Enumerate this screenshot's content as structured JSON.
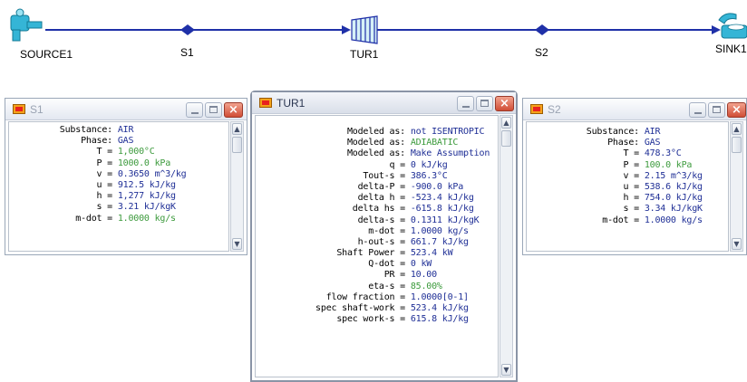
{
  "diagram": {
    "nodes": {
      "source": {
        "label": "SOURCE1",
        "icon": "faucet-icon"
      },
      "s1": {
        "label": "S1",
        "icon": "stream-diamond-icon"
      },
      "tur": {
        "label": "TUR1",
        "icon": "turbine-icon"
      },
      "s2": {
        "label": "S2",
        "icon": "stream-diamond-icon"
      },
      "sink": {
        "label": "SINK1",
        "icon": "sink-icon"
      }
    },
    "line_color": "#1f30a8",
    "icon_color": "#35b5d6"
  },
  "windows": {
    "s1": {
      "title": "S1",
      "rows": [
        {
          "label": "Substance:",
          "value": "AIR"
        },
        {
          "label": "Phase:",
          "value": "GAS"
        },
        {
          "label": "T =",
          "value": "1,000°C",
          "green": true
        },
        {
          "label": "P =",
          "value": "1000.0 kPa",
          "green": true
        },
        {
          "label": "v =",
          "value": "0.3650 m^3/kg"
        },
        {
          "label": "u =",
          "value": "912.5 kJ/kg"
        },
        {
          "label": "h =",
          "value": "1,277 kJ/kg"
        },
        {
          "label": "s =",
          "value": "3.21 kJ/kgK"
        },
        {
          "label": "m-dot =",
          "value": "1.0000 kg/s",
          "green": true
        }
      ]
    },
    "tur": {
      "title": "TUR1",
      "rows": [
        {
          "label": "Modeled as:",
          "value": "not ISENTROPIC"
        },
        {
          "label": "Modeled as:",
          "value": "ADIABATIC",
          "green": true
        },
        {
          "label": "Modeled as:",
          "value": "Make Assumption"
        },
        {
          "label": "q =",
          "value": "0 kJ/kg"
        },
        {
          "label": "Tout-s =",
          "value": "386.3°C"
        },
        {
          "label": "delta-P =",
          "value": "-900.0 kPa"
        },
        {
          "label": "delta h =",
          "value": "-523.4 kJ/kg"
        },
        {
          "label": "delta hs =",
          "value": "-615.8 kJ/kg"
        },
        {
          "label": "delta-s =",
          "value": "0.1311 kJ/kgK"
        },
        {
          "label": "m-dot =",
          "value": "1.0000 kg/s"
        },
        {
          "label": "h-out-s =",
          "value": "661.7 kJ/kg"
        },
        {
          "label": "Shaft Power =",
          "value": "523.4 kW"
        },
        {
          "label": "Q-dot =",
          "value": "0 kW"
        },
        {
          "label": "PR =",
          "value": "10.00"
        },
        {
          "label": "eta-s =",
          "value": "85.00%",
          "green": true
        },
        {
          "label": "flow fraction =",
          "value": "1.0000[0-1]"
        },
        {
          "label": "spec shaft-work =",
          "value": "523.4 kJ/kg"
        },
        {
          "label": "spec work-s =",
          "value": "615.8 kJ/kg"
        }
      ]
    },
    "s2": {
      "title": "S2",
      "rows": [
        {
          "label": "Substance:",
          "value": "AIR"
        },
        {
          "label": "Phase:",
          "value": "GAS"
        },
        {
          "label": "T =",
          "value": "478.3°C"
        },
        {
          "label": "P =",
          "value": "100.0 kPa",
          "green": true
        },
        {
          "label": "v =",
          "value": "2.15 m^3/kg"
        },
        {
          "label": "u =",
          "value": "538.6 kJ/kg"
        },
        {
          "label": "h =",
          "value": "754.0 kJ/kg"
        },
        {
          "label": "s =",
          "value": "3.34 kJ/kgK"
        },
        {
          "label": "m-dot =",
          "value": "1.0000 kg/s"
        }
      ]
    }
  },
  "window_buttons": {
    "minimize": "minimize-icon",
    "maximize": "maximize-icon",
    "close": "×"
  },
  "scroll_glyphs": {
    "up": "▲",
    "down": "▼"
  }
}
